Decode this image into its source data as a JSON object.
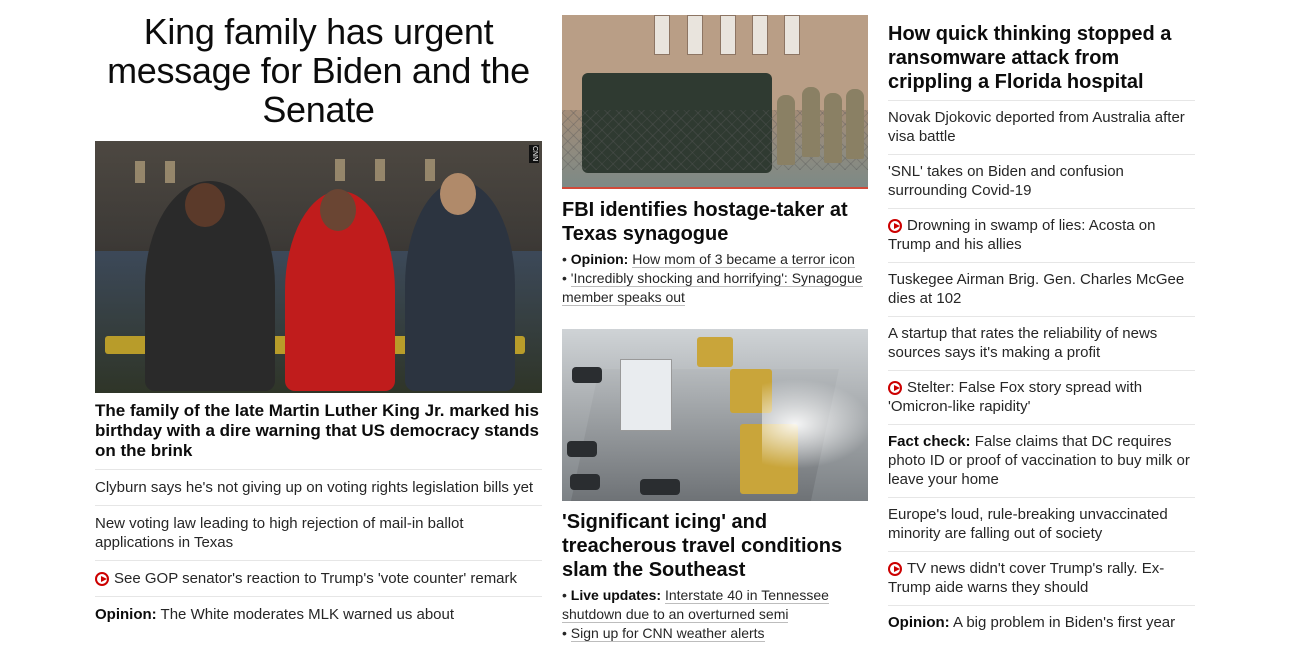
{
  "col1": {
    "headline": "King family has urgent message for Biden and the Senate",
    "hero_caption": "The family of the late Martin Luther King Jr. marked his birthday with a dire warning that US democracy stands on the brink",
    "hero_badge": "CNN",
    "items": [
      {
        "prefix": "",
        "text": "Clyburn says he's not giving up on voting rights legislation bills yet",
        "video": false
      },
      {
        "prefix": "",
        "text": "New voting law leading to high rejection of mail-in ballot applications in Texas",
        "video": false
      },
      {
        "prefix": "",
        "text": "See GOP senator's reaction to Trump's 'vote counter' remark",
        "video": true
      },
      {
        "prefix": "Opinion:",
        "text": " The White moderates MLK warned us about",
        "video": false
      }
    ]
  },
  "col2": {
    "story1": {
      "headline": "FBI identifies hostage-taker at Texas synagogue",
      "subs": [
        {
          "prefix": "Opinion:",
          "text": "How mom of 3 became a terror icon"
        },
        {
          "prefix": "",
          "text": "'Incredibly shocking and horrifying': Synagogue member speaks out"
        }
      ]
    },
    "story2": {
      "headline": "'Significant icing' and treacherous travel conditions slam the Southeast",
      "subs": [
        {
          "prefix": "Live updates:",
          "text": "Interstate 40 in Tennessee shutdown due to an overturned semi"
        },
        {
          "prefix": "",
          "text": "Sign up for CNN weather alerts"
        }
      ]
    }
  },
  "col3": {
    "headline": "How quick thinking stopped a ransomware attack from crippling a Florida hospital",
    "items": [
      {
        "prefix": "",
        "text": "Novak Djokovic deported from Australia after visa battle",
        "video": false
      },
      {
        "prefix": "",
        "text": "'SNL' takes on Biden and confusion surrounding Covid-19",
        "video": false
      },
      {
        "prefix": "",
        "text": "Drowning in swamp of lies: Acosta on Trump and his allies",
        "video": true
      },
      {
        "prefix": "",
        "text": "Tuskegee Airman Brig. Gen. Charles McGee dies at 102",
        "video": false
      },
      {
        "prefix": "",
        "text": "A startup that rates the reliability of news sources says it's making a profit",
        "video": false
      },
      {
        "prefix": "",
        "text": "Stelter: False Fox story spread with 'Omicron-like rapidity'",
        "video": true
      },
      {
        "prefix": "Fact check:",
        "text": " False claims that DC requires photo ID or proof of vaccination to buy milk or leave your home",
        "video": false
      },
      {
        "prefix": "",
        "text": "Europe's loud, rule-breaking unvaccinated minority are falling out of society",
        "video": false
      },
      {
        "prefix": "",
        "text": "TV news didn't cover Trump's rally. Ex-Trump aide warns they should",
        "video": true
      },
      {
        "prefix": "Opinion:",
        "text": " A big problem in Biden's first year",
        "video": false
      }
    ]
  },
  "icons": {
    "video": "play-circle-icon"
  },
  "colors": {
    "accent_red": "#cc0000",
    "text": "#0c0c0c",
    "divider": "#e6e6e6"
  }
}
